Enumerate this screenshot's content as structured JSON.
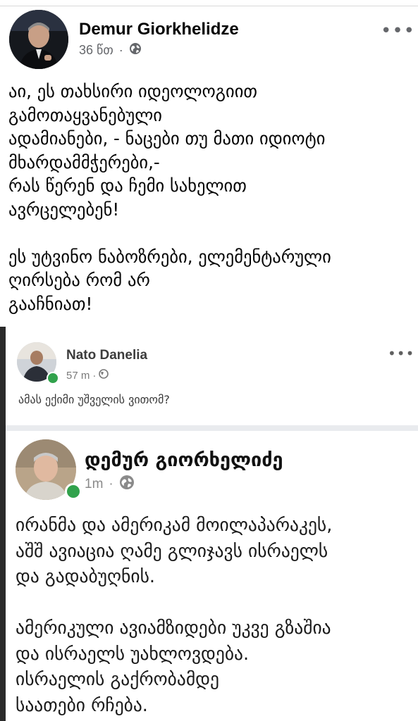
{
  "post": {
    "author": "Demur Giorkhelidze",
    "time": "36 წთ",
    "privacy_icon": "globe-icon",
    "more_icon": "more-options-icon",
    "body_lines": [
      "აი, ეს თახსირი იდეოლოგიით",
      "გამოთაყვანებული",
      "ადამიანები, - ნაცები თუ მათი იდიოტი",
      "მხარდამმჭერები,-",
      "რას წერენ და ჩემი სახელით",
      "ავრცელებენ!",
      "",
      "ეს უტვინო ნაბოზრები, ელემენტარული",
      "ღირსება რომ არ",
      "გააჩნიათ!"
    ]
  },
  "screenshot": {
    "comment": {
      "author": "Nato Danelia",
      "time": "57 m",
      "text": "ამას ექიმი უშველის ვითომ?"
    },
    "shared_post": {
      "author": "დემურ გიორხელიძე",
      "time": "1m",
      "paragraph1": [
        "ირანმა და ამერიკამ მოილაპარაკეს,",
        "აშშ ავიაცია ღამე გლიჯავს ისრაელს",
        "და გადაბუღნის."
      ],
      "paragraph2": [
        "ამერიკული ავიამზიდები უკვე გზაშია",
        "და ისრაელს უახლოვდება.",
        "ისრაელის გაქრობამდე",
        "საათები რჩება."
      ]
    }
  },
  "colors": {
    "text_primary": "#050505",
    "text_secondary": "#65676b",
    "online_green": "#31a24c",
    "separator": "#e9ebee"
  }
}
